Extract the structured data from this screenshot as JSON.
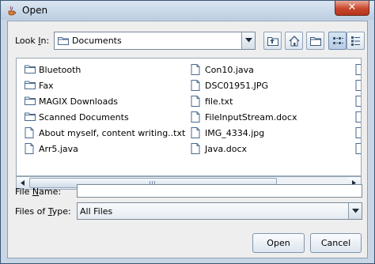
{
  "window": {
    "title": "Open",
    "close_label": "✕"
  },
  "look_in": {
    "label_pre": "Look ",
    "label_underline": "I",
    "label_post": "n:",
    "value": "Documents"
  },
  "toolbar": {
    "buttons": [
      {
        "name": "up-one-level-button",
        "icon": "up-folder-icon"
      },
      {
        "name": "home-button",
        "icon": "home-icon"
      },
      {
        "name": "new-folder-button",
        "icon": "new-folder-icon"
      },
      {
        "name": "list-view-button",
        "icon": "list-view-icon",
        "selected": true
      },
      {
        "name": "details-view-button",
        "icon": "details-view-icon"
      }
    ]
  },
  "files": {
    "col1": [
      {
        "name": "Bluetooth",
        "type": "folder"
      },
      {
        "name": "Fax",
        "type": "folder"
      },
      {
        "name": "MAGIX Downloads",
        "type": "folder"
      },
      {
        "name": "Scanned Documents",
        "type": "folder"
      },
      {
        "name": "About myself, content writing..txt",
        "type": "file"
      },
      {
        "name": "Arr5.java",
        "type": "file"
      }
    ],
    "col2": [
      {
        "name": "Con10.java",
        "type": "file"
      },
      {
        "name": "DSC01951.JPG",
        "type": "file"
      },
      {
        "name": "file.txt",
        "type": "file"
      },
      {
        "name": "FileInputStream.docx",
        "type": "file"
      },
      {
        "name": "IMG_4334.jpg",
        "type": "file"
      },
      {
        "name": "Java.docx",
        "type": "file"
      }
    ]
  },
  "file_name": {
    "label_pre": "File ",
    "label_underline": "N",
    "label_post": "ame:",
    "value": ""
  },
  "files_of_type": {
    "label_pre": "Files of ",
    "label_underline": "T",
    "label_post": "ype:",
    "value": "All Files"
  },
  "actions": {
    "open_label": "Open",
    "cancel_label": "Cancel"
  },
  "colors": {
    "title_bar": "#bccde0",
    "close_button": "#c8462b",
    "dialog_bg": "#eeeeee"
  }
}
